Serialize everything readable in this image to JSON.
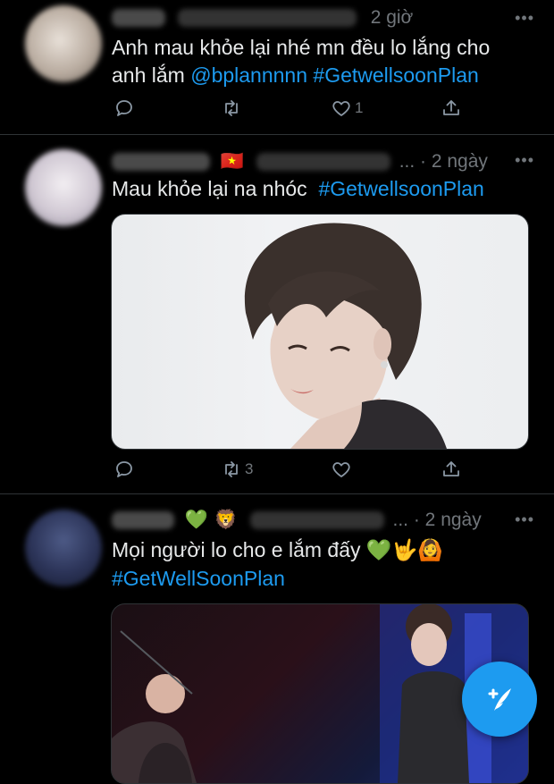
{
  "tweets": [
    {
      "time": "2 giờ",
      "text": "Anh mau khỏe lại nhé mn đều lo lắng cho anh lắm ",
      "mention": "@bplannnnn",
      "hashtag": "#GetwellsoonPlan",
      "reply_count": "",
      "retweet_count": "",
      "like_count": "1"
    },
    {
      "flag": "🇻🇳",
      "time": "... · 2 ngày",
      "text": "Mau khỏe lại na nhóc  ",
      "hashtag": "#GetwellsoonPlan",
      "retweet_count": "3",
      "like_count": ""
    },
    {
      "emoji_name": "💚 🦁",
      "time": "... · 2 ngày",
      "text": "Mọi người lo cho e lắm đấy ",
      "text_emoji": "💚🤟🙆",
      "hashtag": "#GetWellSoonPlan"
    }
  ],
  "colors": {
    "background": "#000000",
    "link": "#1d9bf0",
    "muted": "#71767b",
    "divider": "#2f3336"
  },
  "icons": [
    "reply-icon",
    "retweet-icon",
    "like-icon",
    "share-icon",
    "more-icon",
    "compose-icon"
  ]
}
